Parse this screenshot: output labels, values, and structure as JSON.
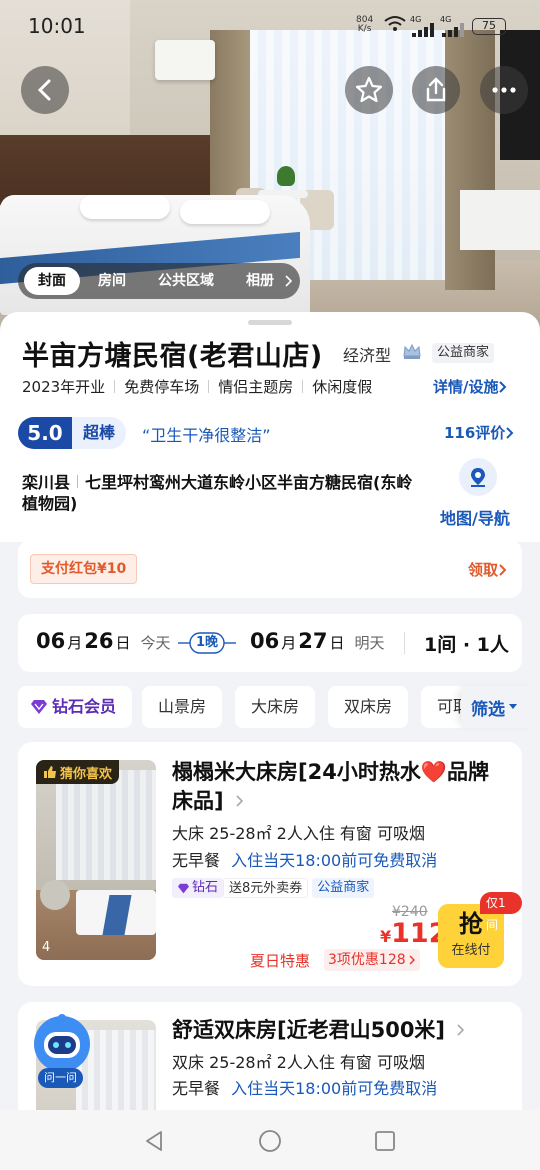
{
  "status_bar": {
    "time": "10:01",
    "net_speed": "804",
    "net_unit": "K/s",
    "sig1": "4G",
    "sig2": "4G",
    "battery": "75"
  },
  "hero": {
    "tabs": [
      {
        "label": "封面",
        "active": true
      },
      {
        "label": "房间"
      },
      {
        "label": "公共区域"
      },
      {
        "label": "相册"
      }
    ]
  },
  "hotel": {
    "name": "半亩方塘民宿(老君山店)",
    "type": "经济型",
    "badge": "公益商家",
    "features": [
      "2023年开业",
      "免费停车场",
      "情侣主题房",
      "休闲度假"
    ],
    "details_link": "详情/设施",
    "score": "5.0",
    "score_word": "超棒",
    "quote": "“卫生干净很整洁”",
    "reviews_link": "116评价",
    "address_county": "栾川县",
    "address_detail": "七里坪村鸾州大道东岭小区半亩方糖民宿(东岭植物园)",
    "map_label": "地图/导航"
  },
  "coupon": {
    "label": "支付红包¥10",
    "action": "领取"
  },
  "dates": {
    "checkin_m": "06",
    "checkin_d": "26",
    "checkin_day": "今天",
    "nights": "1晚",
    "checkout_m": "06",
    "checkout_d": "27",
    "checkout_day": "明天",
    "guests": "1间 · 1人",
    "month_char": "月",
    "day_char": "日"
  },
  "filters": {
    "member": "钻石会员",
    "chips": [
      "山景房",
      "大床房",
      "双床房",
      "可取消"
    ],
    "filter_label": "筛选"
  },
  "rooms": [
    {
      "tag": "猜你喜欢",
      "name": "榻榻米大床房[24小时热水❤️品牌床品]",
      "specs": "大床 25-28㎡ 2人入住 有窗 可吸烟",
      "meal": "无早餐",
      "cancel": "入住当天18:00前可免费取消",
      "promos": [
        "钻石",
        "送8元外卖券",
        "公益商家"
      ],
      "original_price": "¥240",
      "price": "112",
      "currency": "¥",
      "promo_name": "夏日特惠",
      "discount": "3项优惠128",
      "only": "仅1间",
      "buy_char": "抢",
      "buy_sub": "在线付",
      "photo_count": "4"
    },
    {
      "tag": "问一问",
      "name": "舒适双床房[近老君山500米]",
      "specs": "双床 25-28㎡ 2人入住 有窗 可吸烟",
      "meal": "无早餐",
      "cancel": "入住当天18:00前可免费取消"
    }
  ],
  "colors": {
    "brand_blue": "#1b59b9",
    "price_red": "#e8322a",
    "promo_orange": "#e05a2b",
    "buy_yellow": "#ffd23a"
  }
}
